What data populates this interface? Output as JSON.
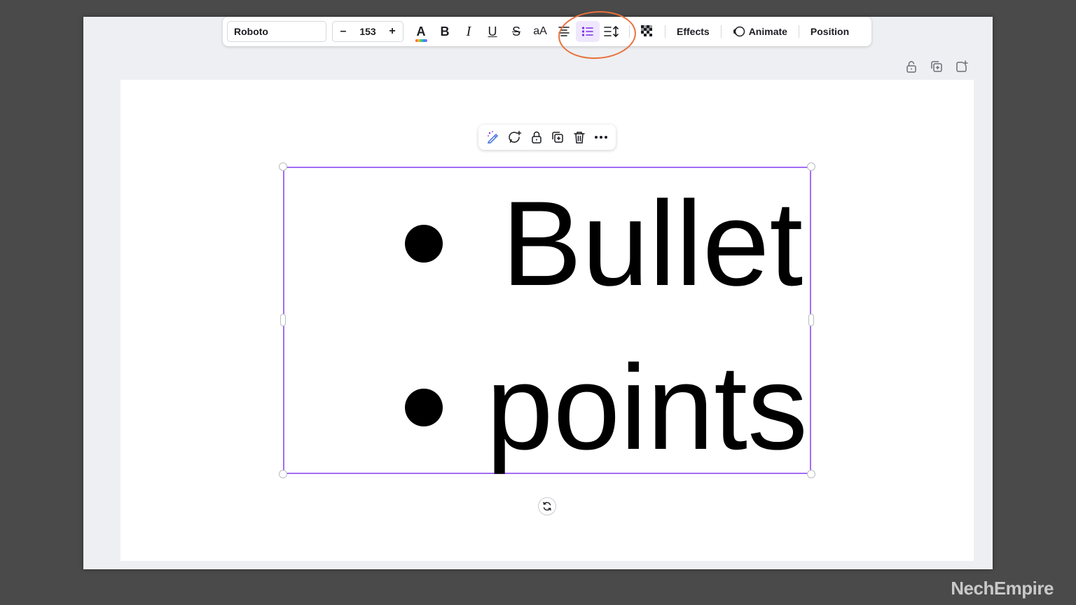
{
  "toolbar": {
    "font_family": "Roboto",
    "font_size": "153",
    "decrease_label": "–",
    "increase_label": "+",
    "text_color_label": "A",
    "bold_label": "B",
    "italic_label": "I",
    "underline_label": "U",
    "strike_label": "S",
    "case_label": "aA",
    "effects_label": "Effects",
    "animate_label": "Animate",
    "position_label": "Position",
    "active_tool": "bullet-list"
  },
  "canvas": {
    "lines": [
      "Bullet",
      "points"
    ]
  },
  "colors": {
    "selection": "#a46cf5",
    "annotation": "#e8713b",
    "active_bg": "#efe7fd",
    "active_fg": "#7d2ae8"
  },
  "watermark": "NechEmpire"
}
